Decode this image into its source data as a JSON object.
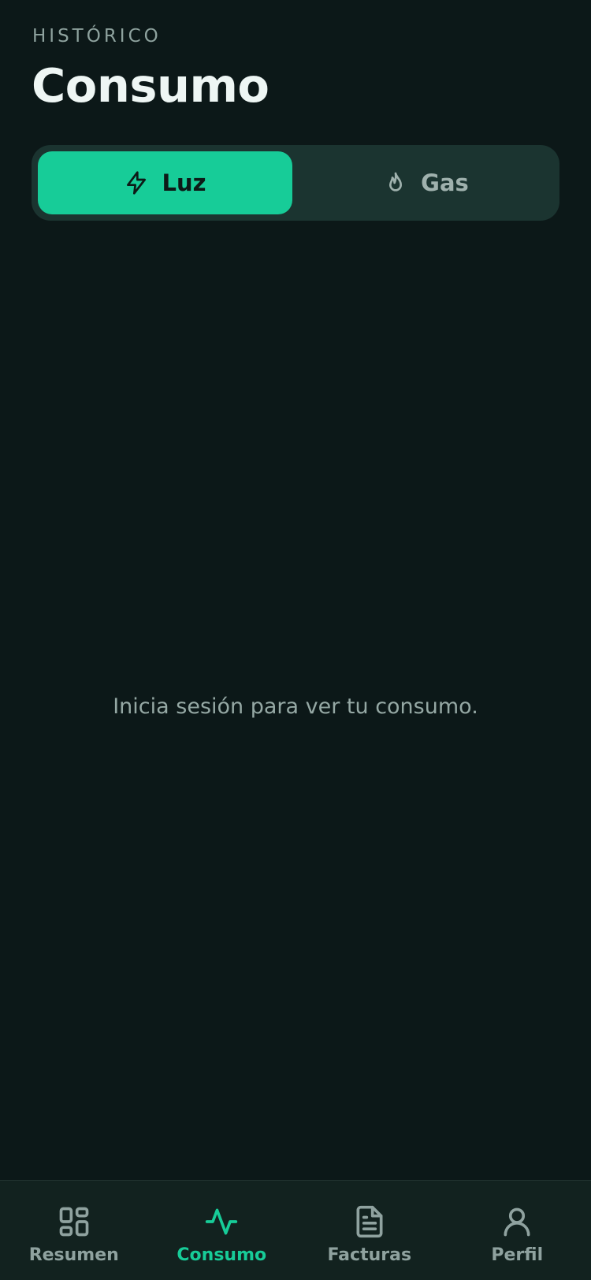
{
  "header": {
    "eyebrow": "HISTÓRICO",
    "title": "Consumo"
  },
  "segmented": {
    "items": [
      {
        "label": "Luz",
        "icon": "bolt-icon",
        "active": true
      },
      {
        "label": "Gas",
        "icon": "flame-icon",
        "active": false
      }
    ]
  },
  "main": {
    "empty_message": "Inicia sesión para ver tu consumo."
  },
  "bottom_nav": {
    "items": [
      {
        "label": "Resumen",
        "icon": "dashboard-icon",
        "active": false
      },
      {
        "label": "Consumo",
        "icon": "activity-icon",
        "active": true
      },
      {
        "label": "Facturas",
        "icon": "document-icon",
        "active": false
      },
      {
        "label": "Perfil",
        "icon": "user-icon",
        "active": false
      }
    ]
  },
  "colors": {
    "background": "#0c1818",
    "accent": "#17cc98",
    "segmented_bg": "#1b3430",
    "nav_bg": "#12221f",
    "muted_text": "#95a8a4",
    "title_text": "#eef6f4"
  }
}
